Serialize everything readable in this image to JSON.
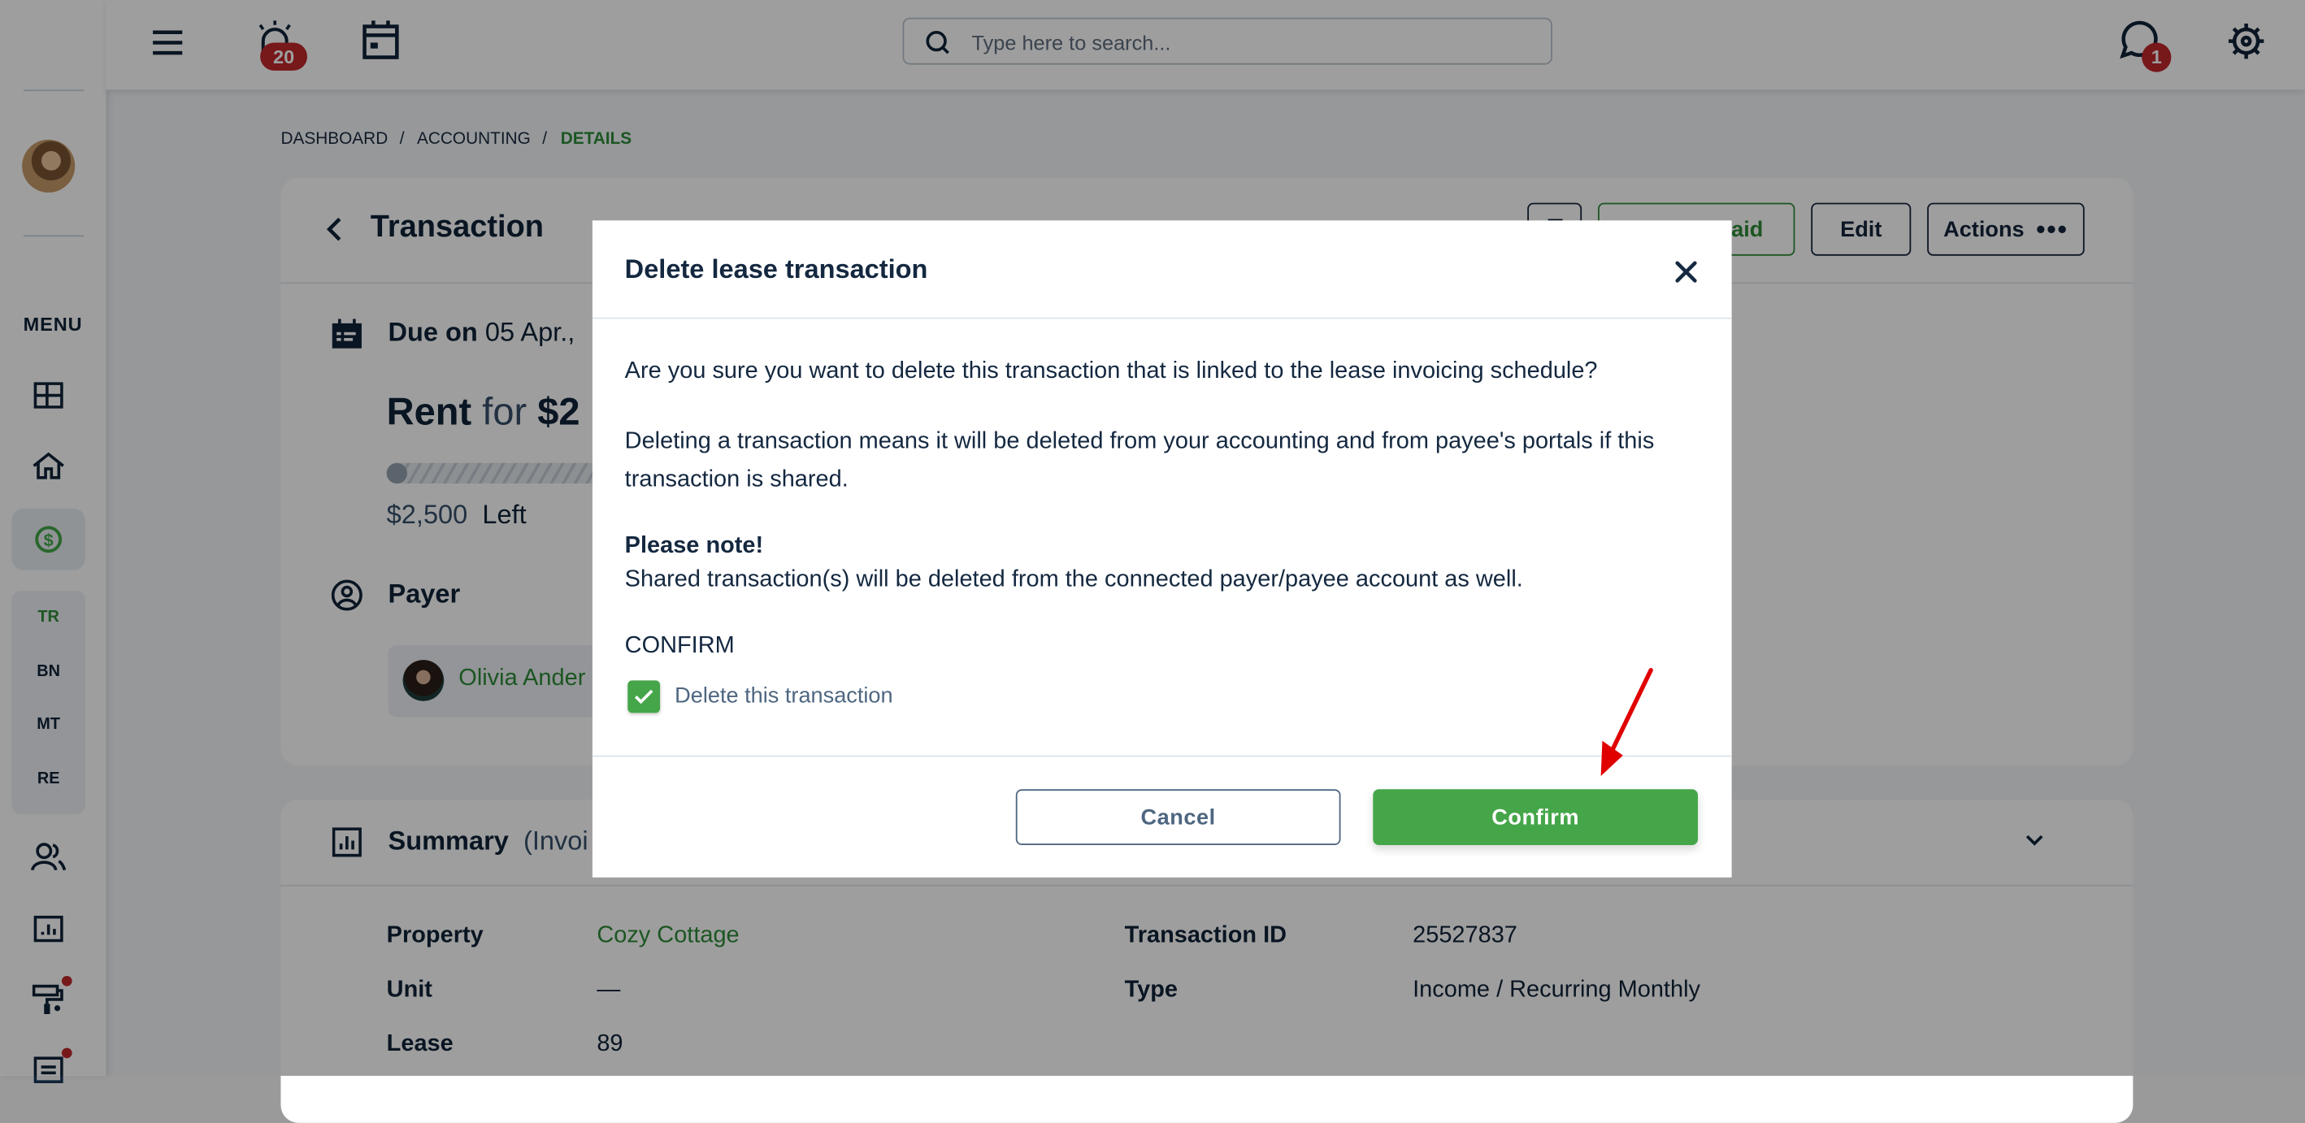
{
  "sidebar": {
    "menu_label": "MENU",
    "items": [
      {
        "icon": "dashboard-grid-icon"
      },
      {
        "icon": "home-icon"
      },
      {
        "icon": "dollar-circle-icon",
        "active": true
      },
      {
        "icon": "users-icon"
      },
      {
        "icon": "report-chart-icon"
      },
      {
        "icon": "paint-roller-icon",
        "has_dot": true
      },
      {
        "icon": "document-list-icon",
        "has_dot": true
      }
    ],
    "subitems": [
      "TR",
      "BN",
      "MT",
      "RE"
    ],
    "active_subitem": "TR"
  },
  "topbar": {
    "alarm_count": "20",
    "search_placeholder": "Type here to search...",
    "chat_count": "1"
  },
  "breadcrumb": [
    "DASHBOARD",
    "ACCOUNTING",
    "DETAILS"
  ],
  "transaction": {
    "title": "Transaction",
    "buttons": {
      "mark_paid": "Mark as paid",
      "edit": "Edit",
      "actions": "Actions"
    },
    "due_label": "Due on",
    "due_date": "05 Apr.,",
    "rent_word": "Rent",
    "for_word": "for",
    "amount": "$2",
    "progress_paid_fraction": 0,
    "left_amount": "$2,500",
    "left_label": "Left",
    "payer_label": "Payer",
    "payer_name": "Olivia Ander"
  },
  "summary": {
    "title": "Summary",
    "subtitle": "(Invoi",
    "rows_left": [
      {
        "label": "Property",
        "value": "Cozy Cottage",
        "link": true
      },
      {
        "label": "Unit",
        "value": "—"
      },
      {
        "label": "Lease",
        "value": "89"
      }
    ],
    "rows_right": [
      {
        "label": "Transaction ID",
        "value": "25527837"
      },
      {
        "label": "Type",
        "value": "Income / Recurring Monthly"
      }
    ]
  },
  "modal": {
    "title": "Delete lease transaction",
    "question": "Are you sure you want to delete this transaction that is linked to the lease invoicing schedule?",
    "explanation": "Deleting a transaction means it will be deleted from your accounting and from payee's portals if this transaction is shared.",
    "note_title": "Please note!",
    "note_text": "Shared transaction(s) will be deleted from the connected payer/payee account as well.",
    "confirm_heading": "CONFIRM",
    "checkbox_label": "Delete this transaction",
    "checkbox_checked": true,
    "cancel_label": "Cancel",
    "confirm_label": "Confirm"
  },
  "colors": {
    "accent_green": "#45a649",
    "link_green": "#2e8b38",
    "badge_red": "#c0272d",
    "text_dark": "#0f2237",
    "annotation_arrow": "#e00000"
  }
}
